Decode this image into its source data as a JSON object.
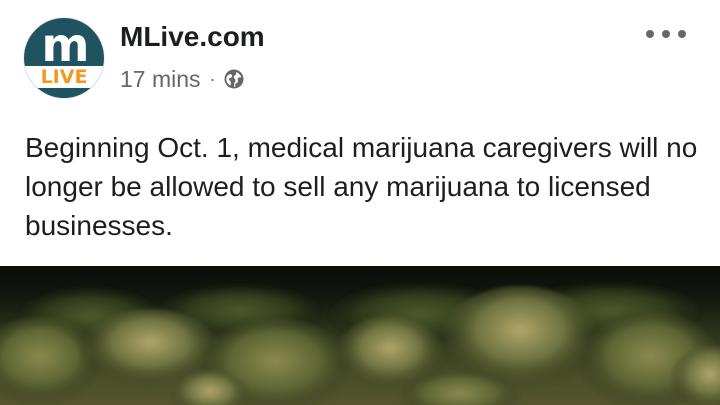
{
  "post": {
    "page_name": "MLive.com",
    "avatar": {
      "letter": "m",
      "band_text": "LIVE",
      "bg_color": "#1f5360",
      "band_text_color": "#f39a1e"
    },
    "timestamp": "17 mins",
    "separator": "·",
    "privacy_icon": "globe-icon",
    "more_icon": "more-options-icon",
    "text": "Beginning Oct. 1, medical marijuana caregivers will no longer be allowed to sell any marijuana to licensed businesses.",
    "image_subject": "marijuana buds"
  }
}
